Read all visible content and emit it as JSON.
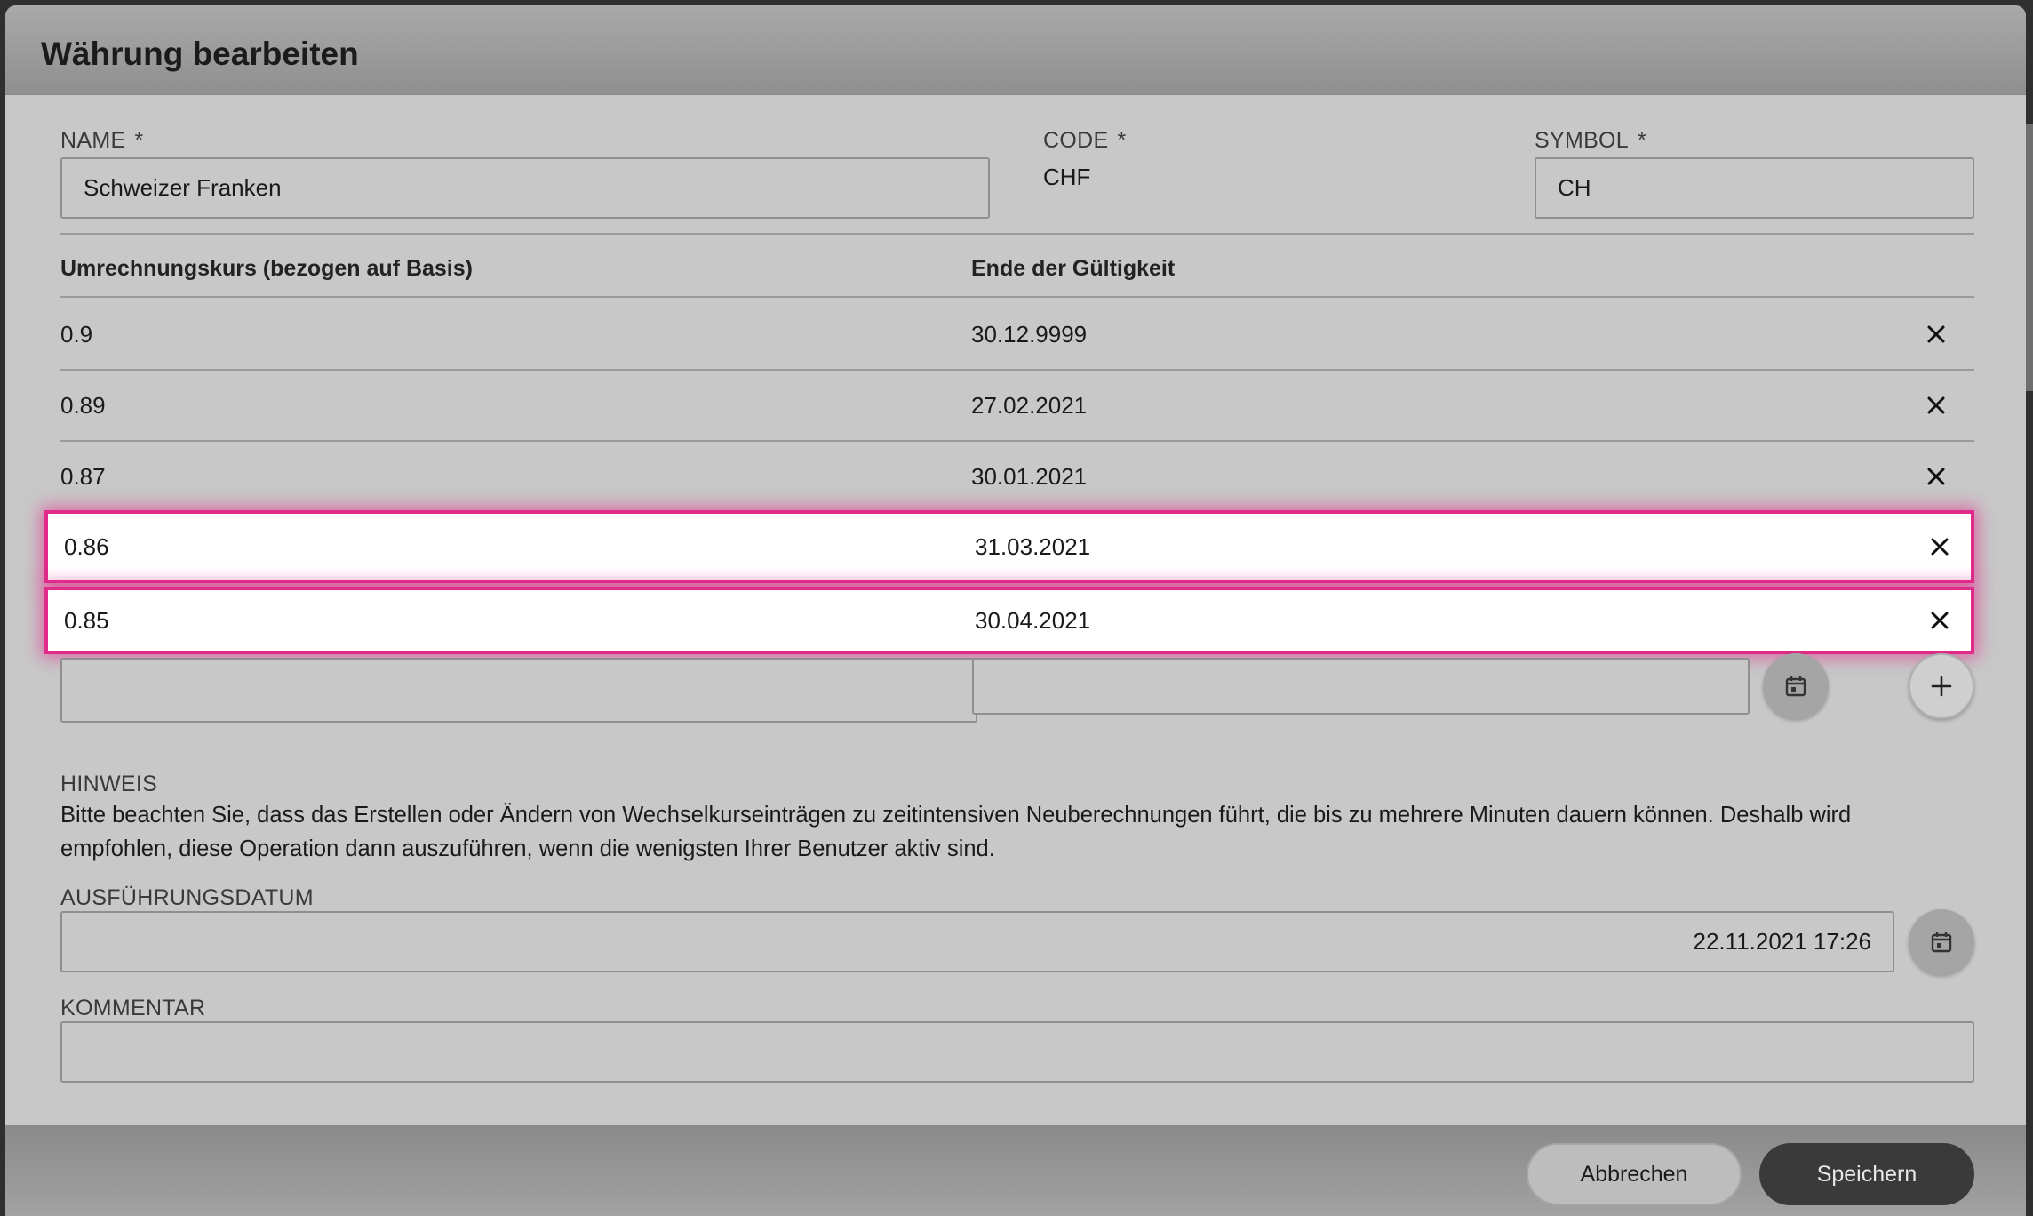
{
  "dialog": {
    "title": "Währung bearbeiten"
  },
  "form": {
    "name": {
      "label": "NAME",
      "required_mark": "*",
      "value": "Schweizer Franken"
    },
    "code": {
      "label": "CODE",
      "required_mark": "*",
      "value": "CHF"
    },
    "symbol": {
      "label": "SYMBOL",
      "required_mark": "*",
      "value": "CH"
    }
  },
  "rates_table": {
    "columns": [
      "Umrechnungskurs (bezogen auf Basis)",
      "Ende der Gültigkeit"
    ],
    "rows": [
      {
        "rate": "0.9",
        "valid_until": "30.12.9999",
        "highlighted": false
      },
      {
        "rate": "0.89",
        "valid_until": "27.02.2021",
        "highlighted": false
      },
      {
        "rate": "0.87",
        "valid_until": "30.01.2021",
        "highlighted": false
      },
      {
        "rate": "0.86",
        "valid_until": "31.03.2021",
        "highlighted": true
      },
      {
        "rate": "0.85",
        "valid_until": "30.04.2021",
        "highlighted": true
      }
    ],
    "new_row": {
      "rate_value": "",
      "date_value": ""
    },
    "delete_icon": "close-icon",
    "add_icon": "plus-icon",
    "calendar_icon": "calendar-icon"
  },
  "notice": {
    "label": "HINWEIS",
    "text": "Bitte beachten Sie, dass das Erstellen oder Ändern von Wechselkurseinträgen zu zeitintensiven Neuberechnungen führt, die bis zu mehrere Minuten dauern können. Deshalb wird empfohlen, diese Operation dann auszuführen, wenn die wenigsten Ihrer Benutzer aktiv sind."
  },
  "execution_date": {
    "label": "AUSFÜHRUNGSDATUM",
    "value": "22.11.2021 17:26"
  },
  "comment": {
    "label": "KOMMENTAR",
    "value": ""
  },
  "footer": {
    "cancel_label": "Abbrechen",
    "save_label": "Speichern"
  },
  "colors": {
    "highlight": "#e02b8a",
    "save_button": "#3a3a3a",
    "dialog_bg": "#c8c8c8"
  }
}
